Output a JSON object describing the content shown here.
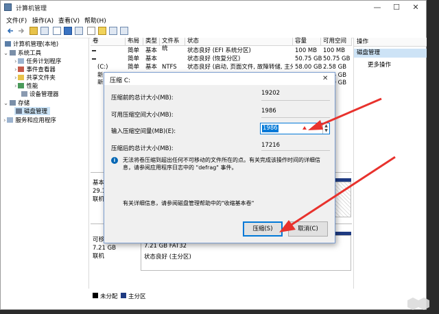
{
  "window": {
    "title": "计算机管理",
    "minimize": "—",
    "maximize": "☐",
    "close": "✕"
  },
  "menu": [
    "文件(F)",
    "操作(A)",
    "查看(V)",
    "帮助(H)"
  ],
  "tree": {
    "root": "计算机管理(本地)",
    "system_tools": "系统工具",
    "task_scheduler": "任务计划程序",
    "event_viewer": "事件查看器",
    "shared_folders": "共享文件夹",
    "performance": "性能",
    "device_manager": "设备管理器",
    "storage": "存储",
    "disk_management": "磁盘管理",
    "services": "服务和应用程序"
  },
  "volume_list": {
    "headers": [
      "卷",
      "布局",
      "类型",
      "文件系统",
      "状态",
      "容量",
      "可用空间"
    ],
    "rows": [
      {
        "vol": "",
        "layout": "简单",
        "type": "基本",
        "fs": "",
        "status": "状态良好 (EFI 系统分区)",
        "cap": "100 MB",
        "free": "100 MB"
      },
      {
        "vol": "",
        "layout": "简单",
        "type": "基本",
        "fs": "",
        "status": "状态良好 (恢复分区)",
        "cap": "50.75 GB",
        "free": "50.75 GB"
      },
      {
        "vol": "(C:)",
        "layout": "简单",
        "type": "基本",
        "fs": "NTFS",
        "status": "状态良好 (启动, 页面文件, 故障转储, 主分区)",
        "cap": "58.00 GB",
        "free": "2.58 GB"
      },
      {
        "vol": "新",
        "layout": "",
        "type": "",
        "fs": "",
        "status": "",
        "cap": "",
        "free": "1.86 GB"
      },
      {
        "vol": "新",
        "layout": "",
        "type": "",
        "fs": "",
        "status": "",
        "cap": "",
        "free": "1.39 GB"
      }
    ]
  },
  "actions": {
    "header": "操作",
    "section": "磁盘管理",
    "more": "更多操作"
  },
  "graph": {
    "disk0_type": "基本",
    "disk0_size": "29.1",
    "disk0_status": "联机",
    "disk1_type": "可移",
    "disk1_size": "7.21 GB",
    "disk1_status": "联机",
    "part_size": "7.21 GB FAT32",
    "part_status": "状态良好 (主分区)"
  },
  "legend": {
    "unallocated": "未分配",
    "primary": "主分区"
  },
  "dialog": {
    "title": "压缩 C:",
    "close": "✕",
    "total_before_label": "压缩前的总计大小(MB):",
    "total_before_value": "19202",
    "available_label": "可用压缩空间大小(MB):",
    "available_value": "1986",
    "input_label": "输入压缩空间量(MB)(E):",
    "input_value": "1986",
    "total_after_label": "压缩后的总计大小(MB):",
    "total_after_value": "17216",
    "info_text": "无法将卷压缩到超出任何不可移动的文件所在的点。有关完成该操作时间的详细信息，请参阅应用程序日志中的 \"defrag\" 事件。",
    "help_text": "有关详细信息，请参阅磁盘管理帮助中的\"收缩基本卷\"",
    "shrink_button": "压缩(S)",
    "cancel_button": "取消(C)"
  },
  "colors": {
    "arrow": "#e8322d",
    "accent": "#0078d7",
    "unallocated": "#000000",
    "primary_partition": "#1f3b82"
  }
}
